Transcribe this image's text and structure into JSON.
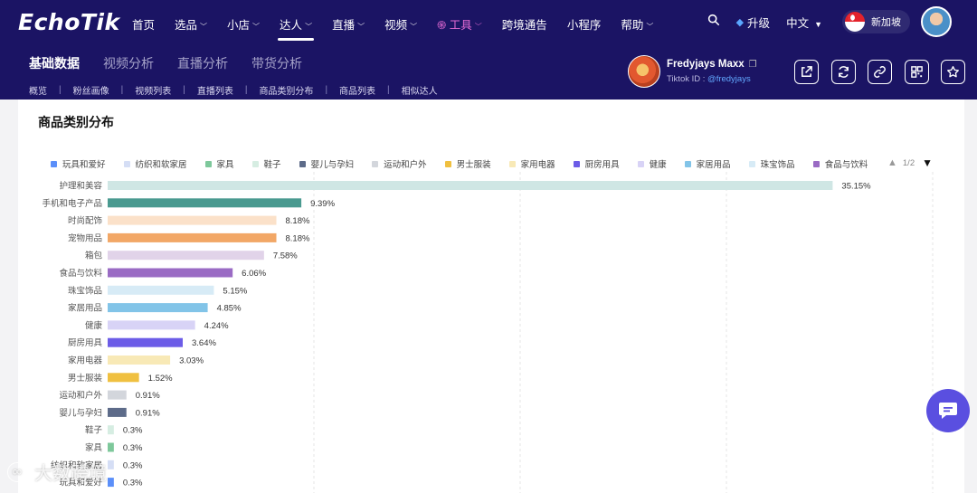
{
  "header": {
    "logo": "EchoTik",
    "nav": [
      {
        "label": "首页",
        "chevron": false,
        "active": false
      },
      {
        "label": "选品",
        "chevron": true,
        "active": false
      },
      {
        "label": "小店",
        "chevron": true,
        "active": false
      },
      {
        "label": "达人",
        "chevron": true,
        "active": true
      },
      {
        "label": "直播",
        "chevron": true,
        "active": false
      },
      {
        "label": "视频",
        "chevron": true,
        "active": false
      },
      {
        "label": "工具",
        "chevron": true,
        "active": false,
        "accent": "#e26ad3"
      },
      {
        "label": "跨境通告",
        "chevron": false,
        "active": false
      },
      {
        "label": "小程序",
        "chevron": false,
        "active": false
      },
      {
        "label": "帮助",
        "chevron": true,
        "active": false
      }
    ],
    "upgrade_label": "升级",
    "language": "中文",
    "region": "新加坡",
    "colors": {
      "background": "#1b1464",
      "accent": "#e26ad3",
      "link": "#62a8ff"
    }
  },
  "subnav": {
    "tabs": [
      "基础数据",
      "视频分析",
      "直播分析",
      "带货分析"
    ],
    "active_tab": 0,
    "sub_links": [
      "概览",
      "粉丝画像",
      "视频列表",
      "直播列表",
      "商品类别分布",
      "商品列表",
      "相似达人"
    ]
  },
  "profile": {
    "name": "Fredyjays Maxx",
    "id_label": "Tiktok ID : ",
    "handle": "@fredyjays"
  },
  "actions": [
    "share-icon",
    "refresh-icon",
    "link-icon",
    "qr-code-icon",
    "favorite-star-icon"
  ],
  "card": {
    "title": "商品类别分布",
    "pager": "1/2"
  },
  "legend": [
    {
      "label": "玩具和爱好",
      "color": "#5b8ff9"
    },
    {
      "label": "纺织和软家居",
      "color": "#d5def5"
    },
    {
      "label": "家具",
      "color": "#7ec89b"
    },
    {
      "label": "鞋子",
      "color": "#d6ede2"
    },
    {
      "label": "婴儿与孕妇",
      "color": "#5d6b89"
    },
    {
      "label": "运动和户外",
      "color": "#d3d6dc"
    },
    {
      "label": "男士服装",
      "color": "#f0c040"
    },
    {
      "label": "家用电器",
      "color": "#f8e9b6"
    },
    {
      "label": "厨房用具",
      "color": "#6c5ce7"
    },
    {
      "label": "健康",
      "color": "#d8d3f6"
    },
    {
      "label": "家居用品",
      "color": "#82c4e8"
    },
    {
      "label": "珠宝饰品",
      "color": "#d7ebf6"
    },
    {
      "label": "食品与饮料",
      "color": "#9a6bc4"
    }
  ],
  "chart_data": {
    "type": "bar",
    "orientation": "horizontal",
    "xlim": [
      0,
      40
    ],
    "grid": true,
    "categories": [
      "护理和美容",
      "手机和电子产品",
      "时尚配饰",
      "宠物用品",
      "箱包",
      "食品与饮料",
      "珠宝饰品",
      "家居用品",
      "健康",
      "厨房用具",
      "家用电器",
      "男士服装",
      "运动和户外",
      "婴儿与孕妇",
      "鞋子",
      "家具",
      "纺织和软家居",
      "玩具和爱好"
    ],
    "values": [
      35.15,
      9.39,
      8.18,
      8.18,
      7.58,
      6.06,
      5.15,
      4.85,
      4.24,
      3.64,
      3.03,
      1.52,
      0.91,
      0.91,
      0.3,
      0.3,
      0.3,
      0.3
    ],
    "value_labels": [
      "35.15%",
      "9.39%",
      "8.18%",
      "8.18%",
      "7.58%",
      "6.06%",
      "5.15%",
      "4.85%",
      "4.24%",
      "3.64%",
      "3.03%",
      "1.52%",
      "0.91%",
      "0.91%",
      "0.3%",
      "0.3%",
      "0.3%",
      "0.3%"
    ],
    "colors": [
      "#cfe6e4",
      "#4a9a90",
      "#fbe1c9",
      "#f2a766",
      "#e1d3e9",
      "#9a6bc4",
      "#d7ebf6",
      "#82c4e8",
      "#d8d3f6",
      "#6c5ce7",
      "#f8e9b6",
      "#f0c040",
      "#d3d6dc",
      "#5d6b89",
      "#d6ede2",
      "#7ec89b",
      "#d5def5",
      "#5b8ff9"
    ]
  },
  "watermark": "大数跨境"
}
